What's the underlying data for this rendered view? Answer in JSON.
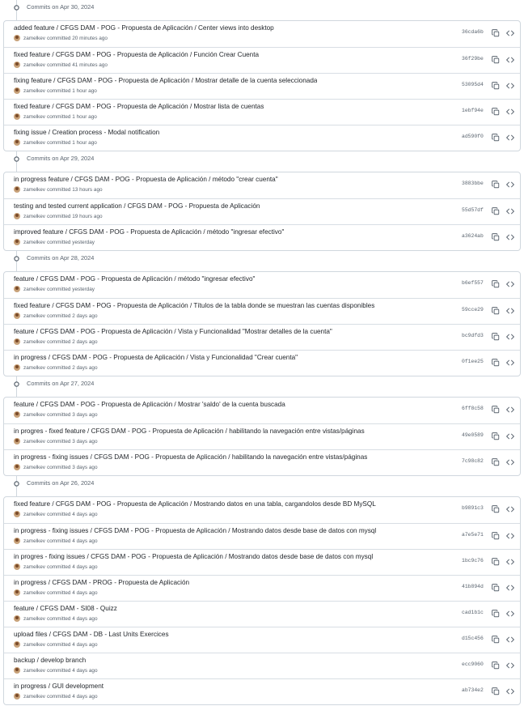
{
  "groups": [
    {
      "date": "Commits on Apr 30, 2024",
      "commits": [
        {
          "title": "added feature / CFGS DAM - POG - Propuesta de Aplicación / Center views into desktop",
          "author": "zamelkev",
          "committed": "committed 20 minutes ago",
          "sha": "36cda6b"
        },
        {
          "title": "fixed feature / CFGS DAM - POG - Propuesta de Aplicación / Función Crear Cuenta",
          "author": "zamelkev",
          "committed": "committed 41 minutes ago",
          "sha": "36f29be"
        },
        {
          "title": "fixing feature / CFGS DAM - POG - Propuesta de Aplicación / Mostrar detalle de la cuenta seleccionada",
          "author": "zamelkev",
          "committed": "committed 1 hour ago",
          "sha": "53095d4"
        },
        {
          "title": "fixed feature / CFGS DAM - POG - Propuesta de Aplicación / Mostrar lista de cuentas",
          "author": "zamelkev",
          "committed": "committed 1 hour ago",
          "sha": "1ebf94e"
        },
        {
          "title": "fixing issue / Creation process - Modal notification",
          "author": "zamelkev",
          "committed": "committed 1 hour ago",
          "sha": "ad590f0"
        }
      ]
    },
    {
      "date": "Commits on Apr 29, 2024",
      "commits": [
        {
          "title": "in progress feature / CFGS DAM - POG - Propuesta de Aplicación / método \"crear cuenta\"",
          "author": "zamelkev",
          "committed": "committed 13 hours ago",
          "sha": "3883bbe"
        },
        {
          "title": "testing and tested current application / CFGS DAM - POG - Propuesta de Aplicación",
          "author": "zamelkev",
          "committed": "committed 19 hours ago",
          "sha": "55d57df"
        },
        {
          "title": "improved feature / CFGS DAM - POG - Propuesta de Aplicación / método \"ingresar efectivo\"",
          "author": "zamelkev",
          "committed": "committed yesterday",
          "sha": "a3624ab"
        }
      ]
    },
    {
      "date": "Commits on Apr 28, 2024",
      "commits": [
        {
          "title": "feature / CFGS DAM - POG - Propuesta de Aplicación / método \"ingresar efectivo\"",
          "author": "zamelkev",
          "committed": "committed yesterday",
          "sha": "b6ef557"
        },
        {
          "title": "fixed feature / CFGS DAM - POG - Propuesta de Aplicación / Títulos de la tabla donde se muestran las cuentas disponibles",
          "author": "zamelkev",
          "committed": "committed 2 days ago",
          "sha": "59cce29"
        },
        {
          "title": "feature / CFGS DAM - POG - Propuesta de Aplicación / Vista y Funcionalidad \"Mostrar detalles de la cuenta\"",
          "author": "zamelkev",
          "committed": "committed 2 days ago",
          "sha": "bc9dfd3"
        },
        {
          "title": "in progress / CFGS DAM - POG - Propuesta de Aplicación / Vista y Funcionalidad \"Crear cuenta\"",
          "author": "zamelkev",
          "committed": "committed 2 days ago",
          "sha": "0f1ee25"
        }
      ]
    },
    {
      "date": "Commits on Apr 27, 2024",
      "commits": [
        {
          "title": "feature / CFGS DAM - POG - Propuesta de Aplicación / Mostrar 'saldo' de la cuenta buscada",
          "author": "zamelkev",
          "committed": "committed 3 days ago",
          "sha": "6ff8c58"
        },
        {
          "title": "in progres - fixed feature / CFGS DAM - POG - Propuesta de Aplicación / habilitando la navegación entre vistas/páginas",
          "author": "zamelkev",
          "committed": "committed 3 days ago",
          "sha": "49e0589"
        },
        {
          "title": "in progress - fixing issues / CFGS DAM - POG - Propuesta de Aplicación / habilitando la navegación entre vistas/páginas",
          "author": "zamelkev",
          "committed": "committed 3 days ago",
          "sha": "7c98c82"
        }
      ]
    },
    {
      "date": "Commits on Apr 26, 2024",
      "commits": [
        {
          "title": "fixed feature / CFGS DAM - POG - Propuesta de Aplicación / Mostrando datos en una tabla, cargandolos desde BD MySQL",
          "author": "zamelkev",
          "committed": "committed 4 days ago",
          "sha": "b9891c3"
        },
        {
          "title": "in progress - fixing issues / CFGS DAM - POG - Propuesta de Aplicación / Mostrando datos desde base de datos con mysql",
          "author": "zamelkev",
          "committed": "committed 4 days ago",
          "sha": "a7e5e71"
        },
        {
          "title": "in progres - fixing issues / CFGS DAM - POG - Propuesta de Aplicación / Mostrando datos desde base de datos con mysql",
          "author": "zamelkev",
          "committed": "committed 4 days ago",
          "sha": "1bc9c76"
        },
        {
          "title": "in progress / CFGS DAM - PROG - Propuesta de Aplicación",
          "author": "zamelkev",
          "committed": "committed 4 days ago",
          "sha": "41b894d"
        },
        {
          "title": "feature / CFGS DAM - SI08 - Quizz",
          "author": "zamelkev",
          "committed": "committed 4 days ago",
          "sha": "cad1b1c"
        },
        {
          "title": "upload files / CFGS DAM - DB - Last Units Exercices",
          "author": "zamelkev",
          "committed": "committed 4 days ago",
          "sha": "d15c456"
        },
        {
          "title": "backup / develop branch",
          "author": "zamelkev",
          "committed": "committed 4 days ago",
          "sha": "ecc9060"
        },
        {
          "title": "in progress / GUI development",
          "author": "zamelkev",
          "committed": "committed 4 days ago",
          "sha": "ab734e2"
        }
      ]
    }
  ],
  "icons": {
    "commit_dot": "git-commit-icon",
    "copy": "copy-icon",
    "browse": "code-icon"
  },
  "colors": {
    "border": "#d0d7de",
    "muted_text": "#59636e",
    "text": "#1f2328"
  }
}
